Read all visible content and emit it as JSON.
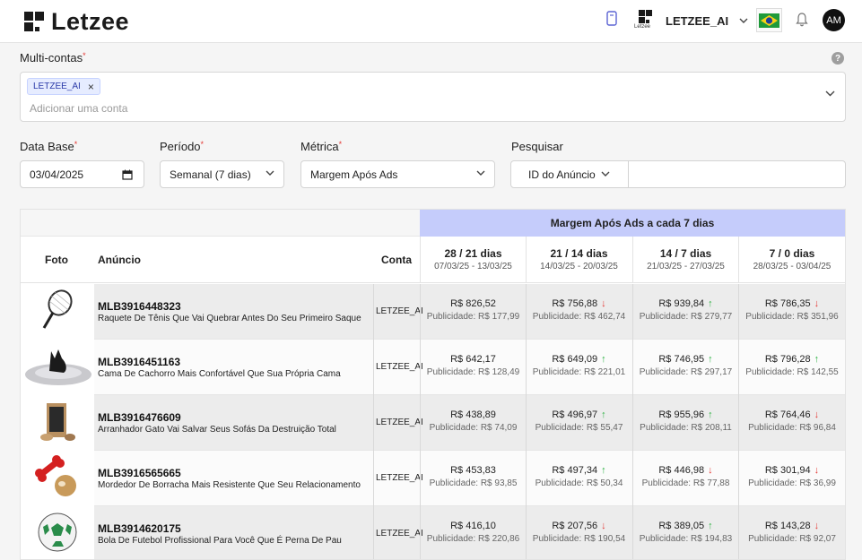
{
  "header": {
    "brand": "Letzee",
    "account_name": "LETZEE_AI",
    "account_logo_text": "Letzee",
    "avatar_initials": "AM",
    "icons": [
      "device-icon",
      "bell-icon",
      "brazil-flag-icon"
    ]
  },
  "multi_contas": {
    "label": "Multi-contas",
    "chip": "LETZEE_AI",
    "placeholder": "Adicionar uma conta"
  },
  "filters": {
    "data_base_label": "Data Base",
    "data_base_value": "03/04/2025",
    "periodo_label": "Período",
    "periodo_value": "Semanal (7 dias)",
    "metrica_label": "Métrica",
    "metrica_value": "Margem Após Ads",
    "pesquisar_label": "Pesquisar",
    "pesquisar_type": "ID do Anúncio",
    "pesquisar_value": ""
  },
  "table": {
    "banner": "Margem Após Ads a cada 7 dias",
    "col_foto": "Foto",
    "col_anuncio": "Anúncio",
    "col_conta": "Conta",
    "periods": [
      {
        "label": "28 / 21 dias",
        "range": "07/03/25 - 13/03/25"
      },
      {
        "label": "21 / 14 dias",
        "range": "14/03/25 - 20/03/25"
      },
      {
        "label": "14 / 7 dias",
        "range": "21/03/25 - 27/03/25"
      },
      {
        "label": "7 / 0 dias",
        "range": "28/03/25 - 03/04/25"
      }
    ],
    "rows": [
      {
        "id": "MLB3916448323",
        "title": "Raquete De Tênis Que Vai Quebrar Antes Do Seu Primeiro Saque",
        "conta": "LETZEE_AI",
        "thumb": "tennis-racket",
        "cells": [
          {
            "value": "R$ 826,52",
            "ads": "Publicidade: R$ 177,99",
            "trend": ""
          },
          {
            "value": "R$ 756,88",
            "ads": "Publicidade: R$ 462,74",
            "trend": "down"
          },
          {
            "value": "R$ 939,84",
            "ads": "Publicidade: R$ 279,77",
            "trend": "up"
          },
          {
            "value": "R$ 786,35",
            "ads": "Publicidade: R$ 351,96",
            "trend": "down"
          }
        ]
      },
      {
        "id": "MLB3916451163",
        "title": "Cama De Cachorro Mais Confortável Que Sua Própria Cama",
        "conta": "LETZEE_AI",
        "thumb": "dog-bed",
        "cells": [
          {
            "value": "R$ 642,17",
            "ads": "Publicidade: R$ 128,49",
            "trend": ""
          },
          {
            "value": "R$ 649,09",
            "ads": "Publicidade: R$ 221,01",
            "trend": "up"
          },
          {
            "value": "R$ 746,95",
            "ads": "Publicidade: R$ 297,17",
            "trend": "up"
          },
          {
            "value": "R$ 796,28",
            "ads": "Publicidade: R$ 142,55",
            "trend": "up"
          }
        ]
      },
      {
        "id": "MLB3916476609",
        "title": "Arranhador Gato Vai Salvar Seus Sofás Da Destruição Total",
        "conta": "LETZEE_AI",
        "thumb": "cat-scratcher",
        "cells": [
          {
            "value": "R$ 438,89",
            "ads": "Publicidade: R$ 74,09",
            "trend": ""
          },
          {
            "value": "R$ 496,97",
            "ads": "Publicidade: R$ 55,47",
            "trend": "up"
          },
          {
            "value": "R$ 955,96",
            "ads": "Publicidade: R$ 208,11",
            "trend": "up"
          },
          {
            "value": "R$ 764,46",
            "ads": "Publicidade: R$ 96,84",
            "trend": "down"
          }
        ]
      },
      {
        "id": "MLB3916565665",
        "title": "Mordedor De Borracha Mais Resistente Que Seu Relacionamento",
        "conta": "LETZEE_AI",
        "thumb": "dog-bone-toy",
        "cells": [
          {
            "value": "R$ 453,83",
            "ads": "Publicidade: R$ 93,85",
            "trend": ""
          },
          {
            "value": "R$ 497,34",
            "ads": "Publicidade: R$ 50,34",
            "trend": "up"
          },
          {
            "value": "R$ 446,98",
            "ads": "Publicidade: R$ 77,88",
            "trend": "down"
          },
          {
            "value": "R$ 301,94",
            "ads": "Publicidade: R$ 36,99",
            "trend": "down"
          }
        ]
      },
      {
        "id": "MLB3914620175",
        "title": "Bola De Futebol Profissional Para Você Que É Perna De Pau",
        "conta": "LETZEE_AI",
        "thumb": "soccer-ball",
        "cells": [
          {
            "value": "R$ 416,10",
            "ads": "Publicidade: R$ 220,86",
            "trend": ""
          },
          {
            "value": "R$ 207,56",
            "ads": "Publicidade: R$ 190,54",
            "trend": "down"
          },
          {
            "value": "R$ 389,05",
            "ads": "Publicidade: R$ 194,83",
            "trend": "up"
          },
          {
            "value": "R$ 143,28",
            "ads": "Publicidade: R$ 92,07",
            "trend": "down"
          }
        ]
      }
    ]
  }
}
